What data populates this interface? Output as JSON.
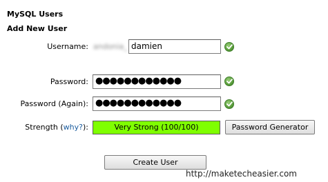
{
  "section": {
    "title": "MySQL Users",
    "subtitle": "Add New User"
  },
  "form": {
    "username": {
      "label": "Username:",
      "prefix": "andonia_",
      "value": "damien"
    },
    "password": {
      "label": "Password:",
      "value": "●●●●●●●●●●●●"
    },
    "password_again": {
      "label": "Password (Again):",
      "value": "●●●●●●●●●●●●"
    },
    "strength": {
      "label_before": "Strength (",
      "link": "why?",
      "label_after": "):",
      "value": "Very Strong (100/100)",
      "score_fraction": 1.0,
      "color": "#7fff00"
    },
    "generator_button": "Password Generator",
    "submit_button": "Create User"
  },
  "watermark": "http://maketecheasier.com",
  "icons": {
    "valid": "check-circle-icon"
  }
}
